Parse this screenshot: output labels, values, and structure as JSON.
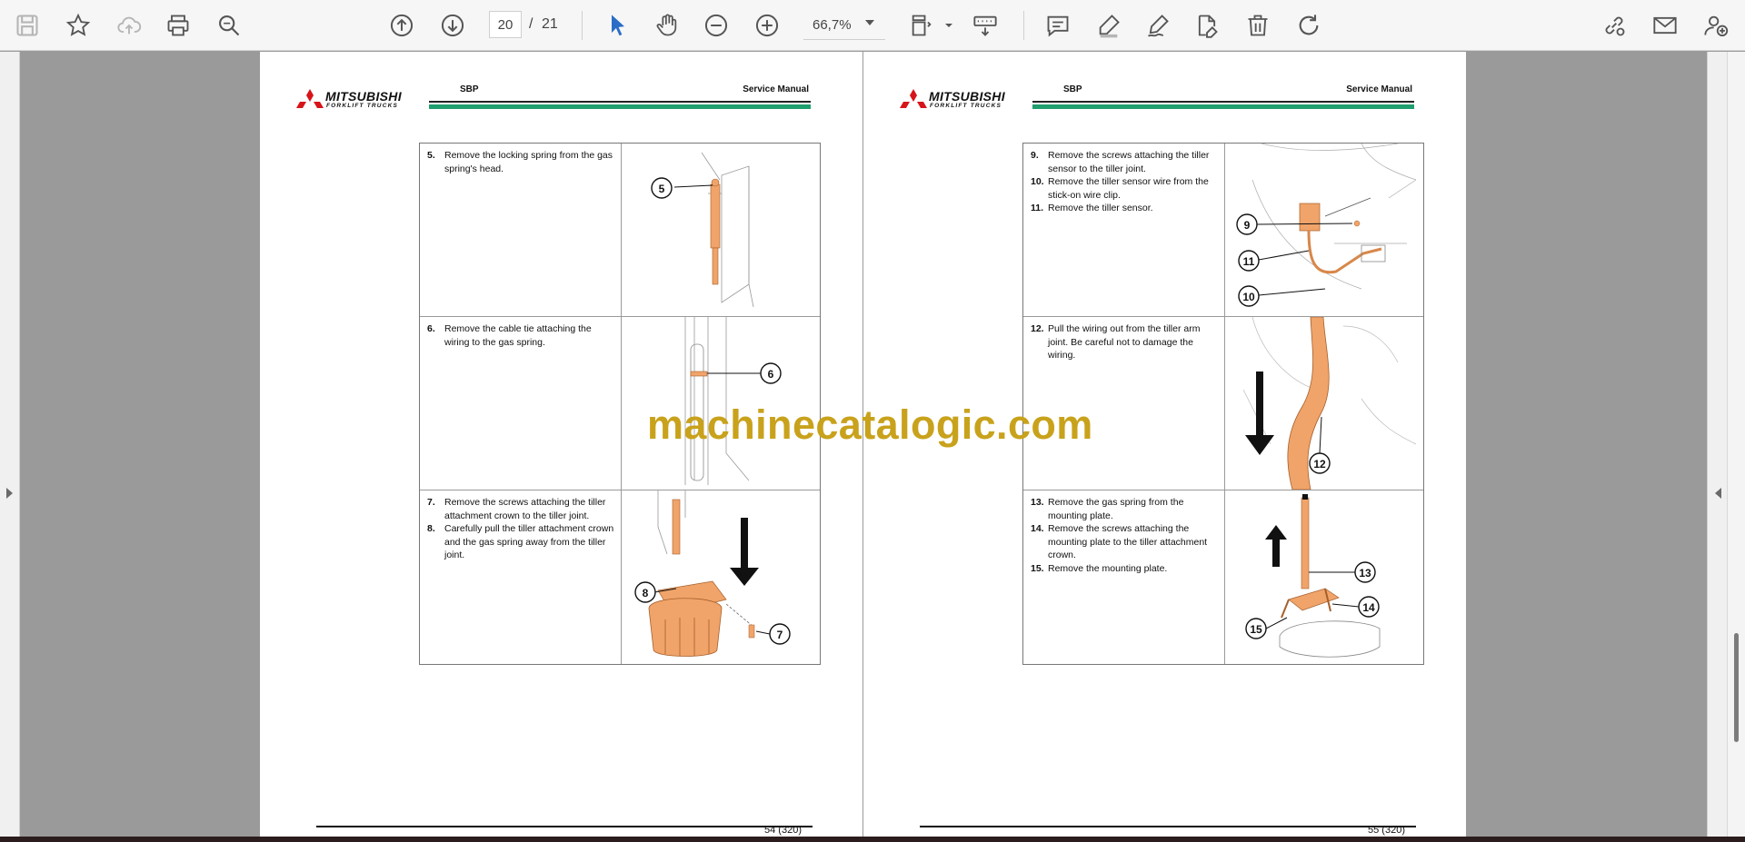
{
  "toolbar": {
    "page_current": "20",
    "page_separator": "/",
    "page_total": "21",
    "zoom": "66,7%"
  },
  "pages": [
    {
      "doc": "SBP",
      "title": "Service Manual",
      "logo_text": "MITSUBISHI",
      "logo_sub": "FORKLIFT TRUCKS",
      "page_no": "54 (320)",
      "rows": [
        {
          "steps": [
            {
              "num": "5.",
              "text": "Remove the locking spring from the gas spring's head."
            }
          ],
          "callouts": [
            "5"
          ]
        },
        {
          "steps": [
            {
              "num": "6.",
              "text": "Remove the cable tie attaching the wiring to the gas spring."
            }
          ],
          "callouts": [
            "6"
          ]
        },
        {
          "steps": [
            {
              "num": "7.",
              "text": "Remove the screws attaching the tiller attachment crown to the tiller joint."
            },
            {
              "num": "8.",
              "text": "Carefully pull the tiller attachment crown and the gas spring away from the tiller joint."
            }
          ],
          "callouts": [
            "8",
            "7"
          ]
        }
      ]
    },
    {
      "doc": "SBP",
      "title": "Service Manual",
      "logo_text": "MITSUBISHI",
      "logo_sub": "FORKLIFT TRUCKS",
      "page_no": "55 (320)",
      "rows": [
        {
          "steps": [
            {
              "num": "9.",
              "text": "Remove the screws attaching the tiller sensor to the tiller joint."
            },
            {
              "num": "10.",
              "text": "Remove the tiller sensor wire from the stick-on wire clip."
            },
            {
              "num": "11.",
              "text": "Remove the tiller sensor."
            }
          ],
          "callouts": [
            "9",
            "11",
            "10"
          ]
        },
        {
          "steps": [
            {
              "num": "12.",
              "text": "Pull the wiring out from the tiller arm joint. Be careful not to damage the wiring."
            }
          ],
          "callouts": [
            "12"
          ]
        },
        {
          "steps": [
            {
              "num": "13.",
              "text": "Remove the gas spring from the mounting plate."
            },
            {
              "num": "14.",
              "text": "Remove the screws attaching the mounting plate to the tiller attachment crown."
            },
            {
              "num": "15.",
              "text": "Remove the mounting plate."
            }
          ],
          "callouts": [
            "13",
            "14",
            "15"
          ]
        }
      ]
    }
  ],
  "watermark": "machinecatalogic.com",
  "colors": {
    "accent_orange": "#f0a46a",
    "header_green": "#1f9e6e",
    "watermark": "#c9a21c",
    "logo_red": "#d7141a"
  }
}
